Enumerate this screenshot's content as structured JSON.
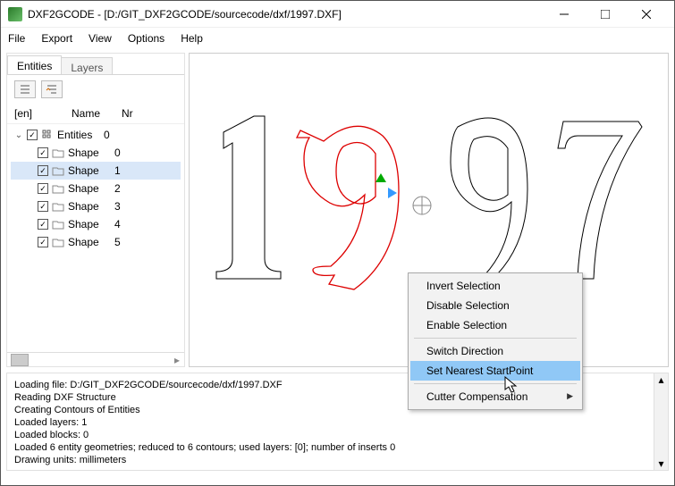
{
  "window": {
    "title": "DXF2GCODE - [D:/GIT_DXF2GCODE/sourcecode/dxf/1997.DXF]"
  },
  "menu": {
    "file": "File",
    "export": "Export",
    "view": "View",
    "options": "Options",
    "help": "Help"
  },
  "sidebar": {
    "tabs": {
      "entities": "Entities",
      "layers": "Layers"
    },
    "headers": {
      "en": "[en]",
      "name": "Name",
      "nr": "Nr"
    },
    "root": {
      "label": "Entities",
      "nr": "0"
    },
    "shapes": [
      {
        "label": "Shape",
        "nr": "0"
      },
      {
        "label": "Shape",
        "nr": "1"
      },
      {
        "label": "Shape",
        "nr": "2"
      },
      {
        "label": "Shape",
        "nr": "3"
      },
      {
        "label": "Shape",
        "nr": "4"
      },
      {
        "label": "Shape",
        "nr": "5"
      }
    ]
  },
  "context_menu": {
    "invert": "Invert Selection",
    "disable": "Disable Selection",
    "enable": "Enable Selection",
    "switch": "Switch Direction",
    "start": "Set Nearest StartPoint",
    "cutter": "Cutter Compensation"
  },
  "status": {
    "l0": "Loading file: D:/GIT_DXF2GCODE/sourcecode/dxf/1997.DXF",
    "l1": "Reading DXF Structure",
    "l2": "Creating Contours of Entities",
    "l3": "Loaded layers: 1",
    "l4": "Loaded blocks: 0",
    "l5": "Loaded 6 entity geometries; reduced to 6 contours; used layers: [0]; number of inserts 0",
    "l6": "Drawing units: millimeters"
  },
  "canvas": {
    "drawing_text": "1997",
    "selected_shape": 1
  }
}
